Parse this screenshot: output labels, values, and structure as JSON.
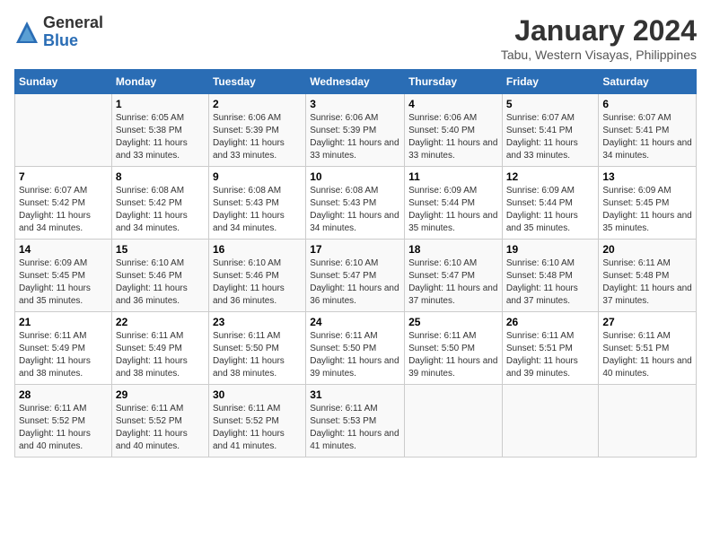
{
  "logo": {
    "general": "General",
    "blue": "Blue"
  },
  "title": "January 2024",
  "subtitle": "Tabu, Western Visayas, Philippines",
  "days_header": [
    "Sunday",
    "Monday",
    "Tuesday",
    "Wednesday",
    "Thursday",
    "Friday",
    "Saturday"
  ],
  "weeks": [
    [
      {
        "num": "",
        "sunrise": "",
        "sunset": "",
        "daylight": ""
      },
      {
        "num": "1",
        "sunrise": "Sunrise: 6:05 AM",
        "sunset": "Sunset: 5:38 PM",
        "daylight": "Daylight: 11 hours and 33 minutes."
      },
      {
        "num": "2",
        "sunrise": "Sunrise: 6:06 AM",
        "sunset": "Sunset: 5:39 PM",
        "daylight": "Daylight: 11 hours and 33 minutes."
      },
      {
        "num": "3",
        "sunrise": "Sunrise: 6:06 AM",
        "sunset": "Sunset: 5:39 PM",
        "daylight": "Daylight: 11 hours and 33 minutes."
      },
      {
        "num": "4",
        "sunrise": "Sunrise: 6:06 AM",
        "sunset": "Sunset: 5:40 PM",
        "daylight": "Daylight: 11 hours and 33 minutes."
      },
      {
        "num": "5",
        "sunrise": "Sunrise: 6:07 AM",
        "sunset": "Sunset: 5:41 PM",
        "daylight": "Daylight: 11 hours and 33 minutes."
      },
      {
        "num": "6",
        "sunrise": "Sunrise: 6:07 AM",
        "sunset": "Sunset: 5:41 PM",
        "daylight": "Daylight: 11 hours and 34 minutes."
      }
    ],
    [
      {
        "num": "7",
        "sunrise": "Sunrise: 6:07 AM",
        "sunset": "Sunset: 5:42 PM",
        "daylight": "Daylight: 11 hours and 34 minutes."
      },
      {
        "num": "8",
        "sunrise": "Sunrise: 6:08 AM",
        "sunset": "Sunset: 5:42 PM",
        "daylight": "Daylight: 11 hours and 34 minutes."
      },
      {
        "num": "9",
        "sunrise": "Sunrise: 6:08 AM",
        "sunset": "Sunset: 5:43 PM",
        "daylight": "Daylight: 11 hours and 34 minutes."
      },
      {
        "num": "10",
        "sunrise": "Sunrise: 6:08 AM",
        "sunset": "Sunset: 5:43 PM",
        "daylight": "Daylight: 11 hours and 34 minutes."
      },
      {
        "num": "11",
        "sunrise": "Sunrise: 6:09 AM",
        "sunset": "Sunset: 5:44 PM",
        "daylight": "Daylight: 11 hours and 35 minutes."
      },
      {
        "num": "12",
        "sunrise": "Sunrise: 6:09 AM",
        "sunset": "Sunset: 5:44 PM",
        "daylight": "Daylight: 11 hours and 35 minutes."
      },
      {
        "num": "13",
        "sunrise": "Sunrise: 6:09 AM",
        "sunset": "Sunset: 5:45 PM",
        "daylight": "Daylight: 11 hours and 35 minutes."
      }
    ],
    [
      {
        "num": "14",
        "sunrise": "Sunrise: 6:09 AM",
        "sunset": "Sunset: 5:45 PM",
        "daylight": "Daylight: 11 hours and 35 minutes."
      },
      {
        "num": "15",
        "sunrise": "Sunrise: 6:10 AM",
        "sunset": "Sunset: 5:46 PM",
        "daylight": "Daylight: 11 hours and 36 minutes."
      },
      {
        "num": "16",
        "sunrise": "Sunrise: 6:10 AM",
        "sunset": "Sunset: 5:46 PM",
        "daylight": "Daylight: 11 hours and 36 minutes."
      },
      {
        "num": "17",
        "sunrise": "Sunrise: 6:10 AM",
        "sunset": "Sunset: 5:47 PM",
        "daylight": "Daylight: 11 hours and 36 minutes."
      },
      {
        "num": "18",
        "sunrise": "Sunrise: 6:10 AM",
        "sunset": "Sunset: 5:47 PM",
        "daylight": "Daylight: 11 hours and 37 minutes."
      },
      {
        "num": "19",
        "sunrise": "Sunrise: 6:10 AM",
        "sunset": "Sunset: 5:48 PM",
        "daylight": "Daylight: 11 hours and 37 minutes."
      },
      {
        "num": "20",
        "sunrise": "Sunrise: 6:11 AM",
        "sunset": "Sunset: 5:48 PM",
        "daylight": "Daylight: 11 hours and 37 minutes."
      }
    ],
    [
      {
        "num": "21",
        "sunrise": "Sunrise: 6:11 AM",
        "sunset": "Sunset: 5:49 PM",
        "daylight": "Daylight: 11 hours and 38 minutes."
      },
      {
        "num": "22",
        "sunrise": "Sunrise: 6:11 AM",
        "sunset": "Sunset: 5:49 PM",
        "daylight": "Daylight: 11 hours and 38 minutes."
      },
      {
        "num": "23",
        "sunrise": "Sunrise: 6:11 AM",
        "sunset": "Sunset: 5:50 PM",
        "daylight": "Daylight: 11 hours and 38 minutes."
      },
      {
        "num": "24",
        "sunrise": "Sunrise: 6:11 AM",
        "sunset": "Sunset: 5:50 PM",
        "daylight": "Daylight: 11 hours and 39 minutes."
      },
      {
        "num": "25",
        "sunrise": "Sunrise: 6:11 AM",
        "sunset": "Sunset: 5:50 PM",
        "daylight": "Daylight: 11 hours and 39 minutes."
      },
      {
        "num": "26",
        "sunrise": "Sunrise: 6:11 AM",
        "sunset": "Sunset: 5:51 PM",
        "daylight": "Daylight: 11 hours and 39 minutes."
      },
      {
        "num": "27",
        "sunrise": "Sunrise: 6:11 AM",
        "sunset": "Sunset: 5:51 PM",
        "daylight": "Daylight: 11 hours and 40 minutes."
      }
    ],
    [
      {
        "num": "28",
        "sunrise": "Sunrise: 6:11 AM",
        "sunset": "Sunset: 5:52 PM",
        "daylight": "Daylight: 11 hours and 40 minutes."
      },
      {
        "num": "29",
        "sunrise": "Sunrise: 6:11 AM",
        "sunset": "Sunset: 5:52 PM",
        "daylight": "Daylight: 11 hours and 40 minutes."
      },
      {
        "num": "30",
        "sunrise": "Sunrise: 6:11 AM",
        "sunset": "Sunset: 5:52 PM",
        "daylight": "Daylight: 11 hours and 41 minutes."
      },
      {
        "num": "31",
        "sunrise": "Sunrise: 6:11 AM",
        "sunset": "Sunset: 5:53 PM",
        "daylight": "Daylight: 11 hours and 41 minutes."
      },
      {
        "num": "",
        "sunrise": "",
        "sunset": "",
        "daylight": ""
      },
      {
        "num": "",
        "sunrise": "",
        "sunset": "",
        "daylight": ""
      },
      {
        "num": "",
        "sunrise": "",
        "sunset": "",
        "daylight": ""
      }
    ]
  ]
}
